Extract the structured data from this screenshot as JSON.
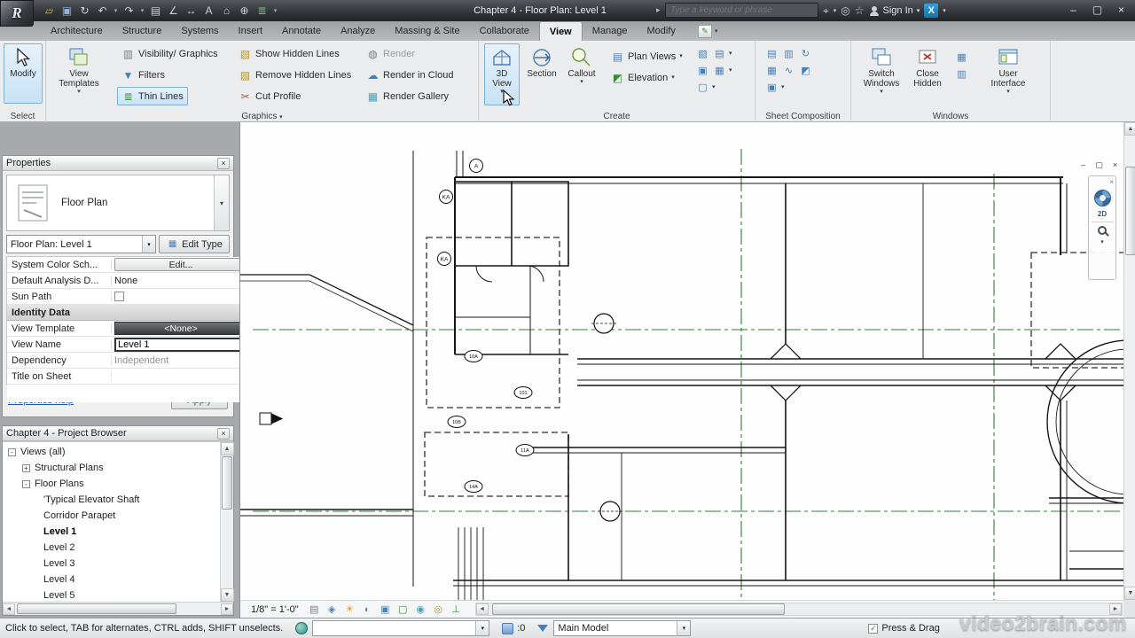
{
  "title_bar": {
    "app_title": "Chapter 4 - Floor Plan: Level 1",
    "search_placeholder": "Type a keyword or phrase",
    "sign_in_label": "Sign In"
  },
  "tabs": [
    "Architecture",
    "Structure",
    "Systems",
    "Insert",
    "Annotate",
    "Analyze",
    "Massing & Site",
    "Collaborate",
    "View",
    "Manage",
    "Modify"
  ],
  "ribbon": {
    "select": {
      "label": "Select",
      "modify": "Modify"
    },
    "graphics": {
      "label": "Graphics",
      "view_templates_line1": "View",
      "view_templates_line2": "Templates",
      "visibility_graphics": "Visibility/ Graphics",
      "filters": "Filters",
      "thin_lines": "Thin Lines",
      "show_hidden_lines": "Show Hidden Lines",
      "remove_hidden_lines": "Remove Hidden Lines",
      "cut_profile": "Cut Profile",
      "render": "Render",
      "render_in_cloud": "Render in Cloud",
      "render_gallery": "Render Gallery"
    },
    "create": {
      "label": "Create",
      "view3d_line1": "3D",
      "view3d_line2": "View",
      "section": "Section",
      "callout": "Callout",
      "plan_views": "Plan Views",
      "elevation": "Elevation"
    },
    "sheet": {
      "label": "Sheet Composition"
    },
    "windows": {
      "label": "Windows",
      "switch_line1": "Switch",
      "switch_line2": "Windows",
      "close_line1": "Close",
      "close_line2": "Hidden",
      "ui_line1": "User",
      "ui_line2": "Interface"
    }
  },
  "properties": {
    "title": "Properties",
    "type_name": "Floor Plan",
    "selector_value": "Floor Plan: Level 1",
    "edit_type_label": "Edit Type",
    "rows": [
      {
        "name": "System Color Sch...",
        "value": "Edit..."
      },
      {
        "name": "Default Analysis D...",
        "value": "None"
      },
      {
        "name": "Sun Path",
        "value": ""
      },
      {
        "name": "Identity Data",
        "value": ""
      },
      {
        "name": "View Template",
        "value": "<None>"
      },
      {
        "name": "View Name",
        "value": "Level 1"
      },
      {
        "name": "Dependency",
        "value": "Independent"
      },
      {
        "name": "Title on Sheet",
        "value": ""
      }
    ],
    "help_link": "Properties help",
    "apply_label": "Apply"
  },
  "project_browser": {
    "title": "Chapter 4 - Project Browser",
    "items": [
      {
        "exp": "-",
        "label": "Views (all)",
        "indent": 0,
        "selected": false
      },
      {
        "exp": "+",
        "label": "Structural Plans",
        "indent": 1,
        "selected": false
      },
      {
        "exp": "-",
        "label": "Floor Plans",
        "indent": 1,
        "selected": false
      },
      {
        "exp": "",
        "label": "'Typical Elevator Shaft",
        "indent": 2,
        "selected": false
      },
      {
        "exp": "",
        "label": "Corridor Parapet",
        "indent": 2,
        "selected": false
      },
      {
        "exp": "",
        "label": "Level 1",
        "indent": 2,
        "selected": true
      },
      {
        "exp": "",
        "label": "Level 2",
        "indent": 2,
        "selected": false
      },
      {
        "exp": "",
        "label": "Level 3",
        "indent": 2,
        "selected": false
      },
      {
        "exp": "",
        "label": "Level 4",
        "indent": 2,
        "selected": false
      },
      {
        "exp": "",
        "label": "Level 5",
        "indent": 2,
        "selected": false
      }
    ]
  },
  "view_bar": {
    "scale": "1/8\" = 1'-0\""
  },
  "status_bar": {
    "hint": "Click to select, TAB for alternates, CTRL adds, SHIFT unselects.",
    "design_option_count": ":0",
    "active_model": "Main Model",
    "press_drag": "Press & Drag"
  },
  "drawing": {
    "door_tags": [
      "10A",
      "101",
      "10B",
      "11A",
      "14A"
    ],
    "grid_bubbles": [
      "A",
      "KA",
      "KA"
    ]
  },
  "colors": {
    "ribbon_highlight": "#c8e2f6",
    "grid_line_green": "#2e7d32",
    "link_blue": "#1f55a8"
  },
  "watermark": "video2brain.com"
}
